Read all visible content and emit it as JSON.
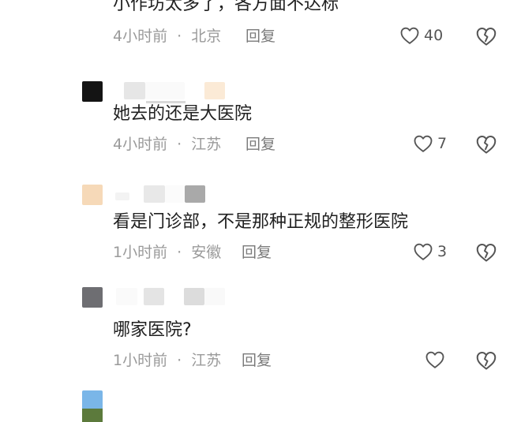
{
  "comments": [
    {
      "text": "小作坊太多了，各方面不达标",
      "time": "4小时前",
      "location": "北京",
      "reply_label": "回复",
      "likes": "40"
    },
    {
      "avatar_color": "#141414",
      "text": "她去的还是大医院",
      "time": "4小时前",
      "location": "江苏",
      "reply_label": "回复",
      "likes": "7"
    },
    {
      "avatar_color": "#f6d9b8",
      "text": "看是门诊部，不是那种正规的整形医院",
      "time": "1小时前",
      "location": "安徽",
      "reply_label": "回复",
      "likes": "3"
    },
    {
      "avatar_color": "#6e6e72",
      "text": "哪家医院?",
      "time": "1小时前",
      "location": "江苏",
      "reply_label": "回复",
      "likes": ""
    },
    {
      "avatar_color": "#7ab6e8",
      "avatar_color_bottom": "#5c7a3c"
    }
  ],
  "separator": "·",
  "icons": {
    "like": "heart-outline-icon",
    "dislike": "broken-heart-icon"
  },
  "colors": {
    "text": "#202020",
    "meta": "#9a9a9a",
    "icon": "#555555"
  }
}
